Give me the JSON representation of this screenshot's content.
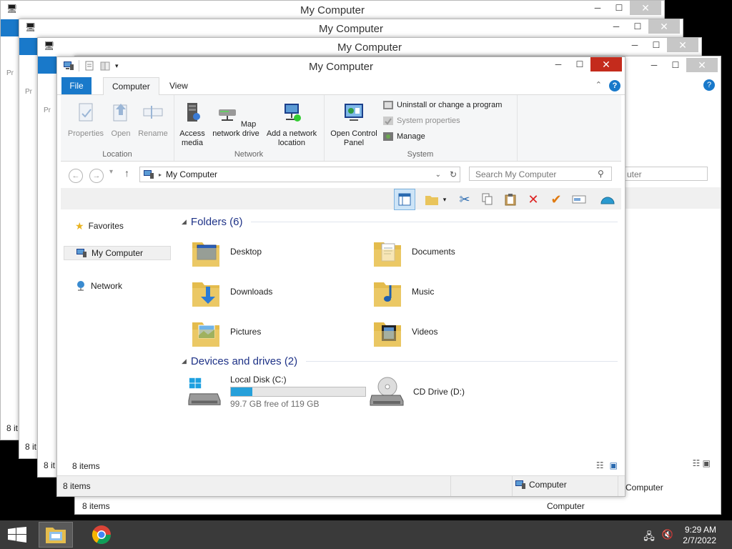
{
  "window": {
    "title": "My Computer",
    "tabs": {
      "file": "File",
      "computer": "Computer",
      "view": "View"
    },
    "ribbon": {
      "location_group": {
        "title": "Location",
        "properties": "Properties",
        "open": "Open",
        "rename": "Rename"
      },
      "network_group": {
        "title": "Network",
        "access_media": "Access media",
        "map_drive": "Map network drive",
        "add_location_1": "Add a network",
        "add_location_2": "location"
      },
      "system_group": {
        "title": "System",
        "open_cp_1": "Open Control",
        "open_cp_2": "Panel",
        "uninstall": "Uninstall or change a program",
        "sys_props": "System properties",
        "manage": "Manage"
      }
    },
    "address": {
      "path": "My Computer",
      "search_placeholder": "Search My Computer"
    },
    "nav": {
      "favorites": "Favorites",
      "computer": "My Computer",
      "network": "Network"
    },
    "folders_header": "Folders (6)",
    "folders": [
      "Desktop",
      "Documents",
      "Downloads",
      "Music",
      "Pictures",
      "Videos"
    ],
    "devices_header": "Devices and drives (2)",
    "drives": {
      "c_name": "Local Disk (C:)",
      "c_free": "99.7 GB free of 119 GB",
      "c_used_fraction": 0.162,
      "d_name": "CD Drive (D:)"
    },
    "items_count": "8 items",
    "status_computer": "Computer"
  },
  "bg_windows": {
    "title": "My Computer",
    "status_left": "8 items",
    "status_short": "8 it",
    "status_computer": "Computer",
    "search_fragment": "uter",
    "ribbon_fragment": "Pr"
  },
  "taskbar": {
    "time": "9:29 AM",
    "date": "2/7/2022"
  },
  "colors": {
    "accent": "#1979ca",
    "close_red": "#c42b1c",
    "taskbar": "#3a3a3a"
  }
}
